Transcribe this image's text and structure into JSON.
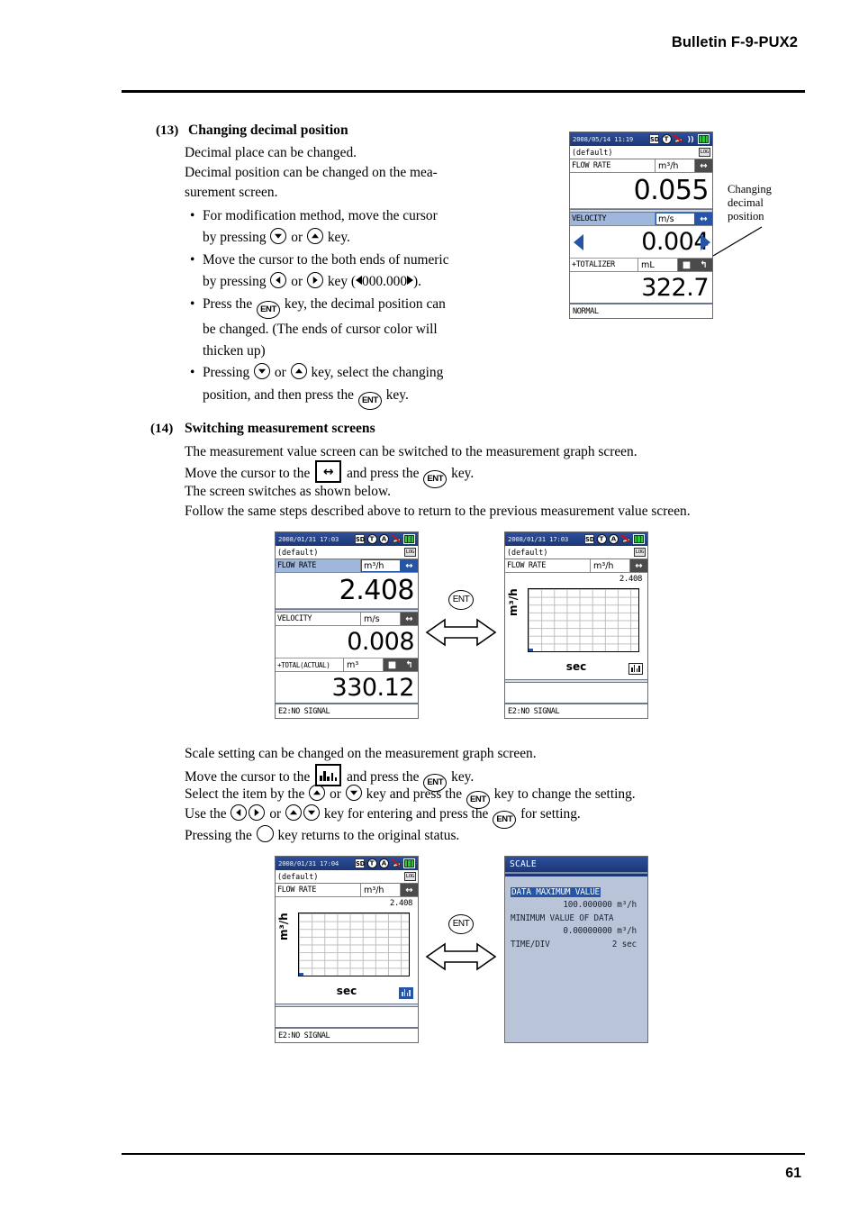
{
  "header": {
    "bulletin": "Bulletin F-9-PUX2"
  },
  "footer": {
    "page_number": "61"
  },
  "section13": {
    "number": "(13)",
    "title": "Changing decimal position",
    "lines": [
      "Decimal place can be changed.",
      "Decimal position can be changed on the mea-",
      "surement screen."
    ],
    "bullets": {
      "b1a": "For modification method, move the cursor",
      "b1b_pre": "by pressing",
      "b1b_mid": "or",
      "b1b_post": "key.",
      "b2a": "Move the cursor to the both ends of numeric",
      "b2b_pre": "by pressing",
      "b2b_mid": "or",
      "b2b_post": "key (",
      "b2b_num": "000.000",
      "b2b_end": ").",
      "b3a_pre": "Press the",
      "b3a_post": "key, the decimal position can",
      "b3b": "be changed. (The ends of cursor color will",
      "b3c": "thicken up)",
      "b4a_pre": "Pressing",
      "b4a_mid": "or",
      "b4a_post": "key, select the changing",
      "b4b_pre": "position, and then press the",
      "b4b_post": "key."
    }
  },
  "section14": {
    "number": "(14)",
    "title": "Switching measurement screens",
    "line1": "The measurement value screen can be switched to the measurement graph screen.",
    "line2_pre": "Move the cursor to the",
    "line2_mid": "and press the",
    "line2_post": "key.",
    "line3": "The screen switches as shown below.",
    "line4": "Follow the same steps described above to return to the previous measurement value screen."
  },
  "scale_instructions": {
    "line1": "Scale setting can be changed on the measurement graph screen.",
    "line2_pre": "Move the cursor to the",
    "line2_mid": "and press the",
    "line2_post": "key.",
    "line3_pre": "Select the item by the",
    "line3_mid": "or",
    "line3_mid2": "key and press the",
    "line3_post": "key to change the setting.",
    "line4_pre": "Use the",
    "line4_mid": "or",
    "line4_mid2": "key for entering and press the",
    "line4_post": "for setting.",
    "line5_pre": "Pressing the",
    "line5_post": "key returns to the original status."
  },
  "annotation": {
    "line1": "Changing",
    "line2": "decimal",
    "line3": "position"
  },
  "lcd_decimal": {
    "datetime": "2008/05/14  11:19",
    "tag": "(default)",
    "log_badge": "LOG",
    "row1": {
      "label": "FLOW RATE",
      "unit": "m³/h",
      "value": "0.055"
    },
    "row2": {
      "label": "VELOCITY",
      "unit": "m/s",
      "value": "0.004"
    },
    "row3": {
      "label": "+TOTALIZER",
      "unit": "mL",
      "value": "322.7"
    },
    "status": "NORMAL"
  },
  "lcd_value": {
    "datetime": "2008/01/31  17:03",
    "tag": "(default)",
    "log_badge": "LOG",
    "row1": {
      "label": "FLOW RATE",
      "unit": "m³/h",
      "value": "2.408"
    },
    "row2": {
      "label": "VELOCITY",
      "unit": "m/s",
      "value": "0.008"
    },
    "row3": {
      "label": "+TOTAL(ACTUAL)",
      "unit": "m³",
      "value": "330.12"
    },
    "status": "E2:NO SIGNAL"
  },
  "lcd_graph_a": {
    "datetime": "2008/01/31  17:03",
    "tag": "(default)",
    "log_badge": "LOG",
    "row1": {
      "label": "FLOW RATE",
      "unit": "m³/h"
    },
    "graph_max": "2.408",
    "ylabel": "m³/h",
    "xlabel": "sec",
    "status": "E2:NO SIGNAL"
  },
  "lcd_graph_b": {
    "datetime": "2008/01/31  17:04",
    "tag": "(default)",
    "log_badge": "LOG",
    "row1": {
      "label": "FLOW RATE",
      "unit": "m³/h"
    },
    "graph_max": "2.408",
    "ylabel": "m³/h",
    "xlabel": "sec",
    "status": "E2:NO SIGNAL"
  },
  "lcd_scale": {
    "title": "SCALE",
    "items": [
      {
        "label": "DATA MAXIMUM VALUE",
        "value": "100.000000",
        "unit": "m³/h",
        "selected": true
      },
      {
        "label": "MINIMUM VALUE OF DATA",
        "value": "0.00000000",
        "unit": "m³/h",
        "selected": false
      }
    ],
    "time_div_label": "TIME/DIV",
    "time_div_value": "2 sec"
  },
  "keys": {
    "ent": "ENT"
  },
  "colors": {
    "lcd_header_blue": "#1b3775",
    "lcd_select_blue": "#2455a8",
    "lcd_select_row": "#9fb7dc",
    "scale_bg": "#b9c4d8"
  }
}
